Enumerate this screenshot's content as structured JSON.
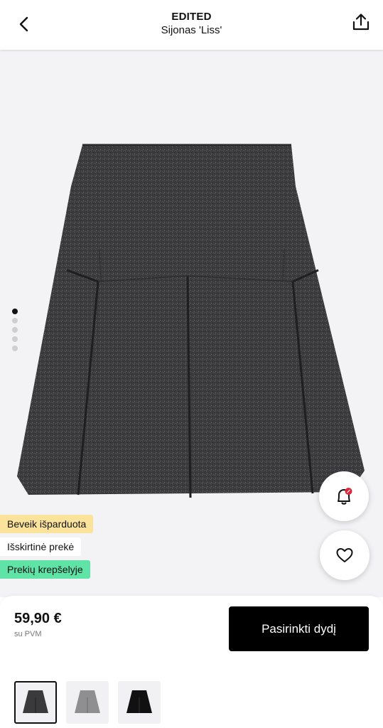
{
  "header": {
    "brand": "EDITED",
    "product_name": "Sijonas 'Liss'"
  },
  "gallery": {
    "image_count": 5,
    "active_index": 0
  },
  "badges": [
    {
      "label": "Beveik išparduota",
      "color": "#fbe39c"
    },
    {
      "label": "Išskirtinė prekė",
      "color": "#ffffff"
    },
    {
      "label": "Prekių krepšelyje",
      "color": "#5fe3a6"
    }
  ],
  "buy": {
    "price": "59,90 €",
    "vat_note": "su PVM",
    "cta_label": "Pasirinkti dydį"
  },
  "variants": [
    {
      "color_hex": "#3a3a3c",
      "selected": true
    },
    {
      "color_hex": "#8f8f92",
      "selected": false
    },
    {
      "color_hex": "#111111",
      "selected": false
    }
  ],
  "icons": {
    "back": "chevron-left-icon",
    "share": "share-icon",
    "bell": "bell-sale-icon",
    "heart": "heart-icon"
  }
}
